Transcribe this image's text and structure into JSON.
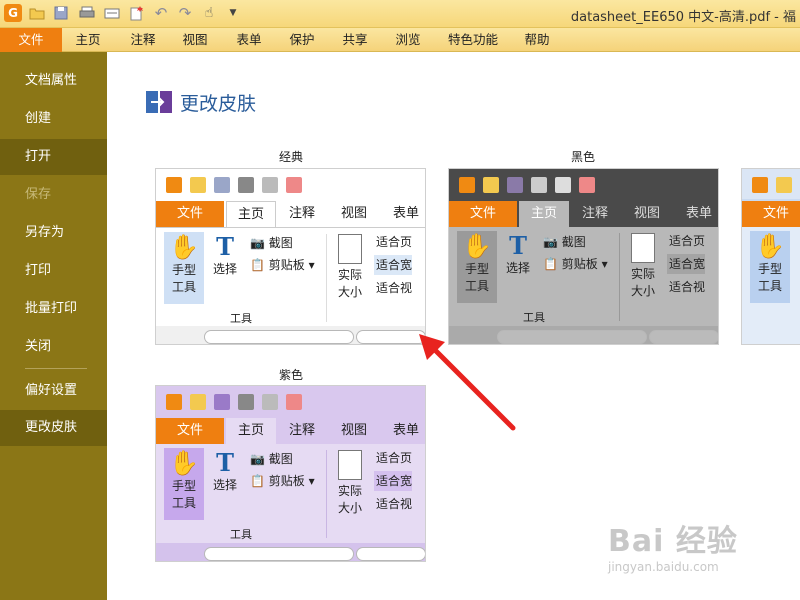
{
  "titlebar": {
    "document_title": "datasheet_EE650 中文-高清.pdf - 福"
  },
  "quick_access": [
    "app-logo",
    "open-folder-icon",
    "save-icon",
    "print-icon",
    "scan-icon",
    "undo-icon",
    "redo-icon",
    "hand-tool-icon",
    "dropdown-arrow-icon"
  ],
  "menu": {
    "items": [
      {
        "label": "文件",
        "active": true
      },
      {
        "label": "主页"
      },
      {
        "label": "注释"
      },
      {
        "label": "视图"
      },
      {
        "label": "表单"
      },
      {
        "label": "保护"
      },
      {
        "label": "共享"
      },
      {
        "label": "浏览"
      },
      {
        "label": "特色功能"
      },
      {
        "label": "帮助"
      }
    ]
  },
  "sidebar": {
    "items": [
      {
        "label": "文档属性"
      },
      {
        "label": "创建"
      },
      {
        "label": "打开",
        "selected": true
      },
      {
        "label": "保存",
        "disabled": true
      },
      {
        "label": "另存为"
      },
      {
        "label": "打印"
      },
      {
        "label": "批量打印"
      },
      {
        "label": "关闭"
      },
      {
        "label": "偏好设置"
      },
      {
        "label": "更改皮肤",
        "selected": true
      }
    ]
  },
  "main": {
    "heading": "更改皮肤",
    "skins": [
      {
        "label": "经典"
      },
      {
        "label": "黑色"
      },
      {
        "label": ""
      },
      {
        "label": "紫色"
      }
    ]
  },
  "preview": {
    "tabs": [
      "文件",
      "主页",
      "注释",
      "视图",
      "表单"
    ],
    "hand_tool": [
      "手型",
      "工具"
    ],
    "select_tool": "选择",
    "screenshot": "截图",
    "clipboard": "剪贴板",
    "group_label": "工具",
    "actual_size": [
      "实际",
      "大小"
    ],
    "fit_page": "适合页",
    "fit_width": "适合宽",
    "fit_visible": "适合视"
  },
  "watermark": {
    "big": "Bai 经验",
    "small": "jingyan.baidu.com"
  },
  "colors": {
    "accent_orange": "#ef7f10",
    "sidebar": "#8b7616",
    "sidebar_selected": "#70600f",
    "arrow_red": "#e8231f"
  }
}
